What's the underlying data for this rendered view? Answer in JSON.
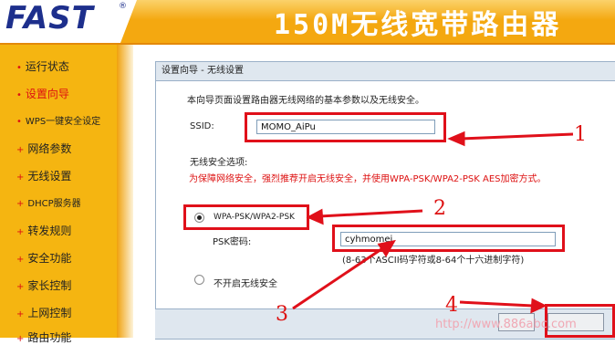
{
  "header": {
    "logo": "FAST",
    "trademark": "®",
    "product_title": "150M无线宽带路由器"
  },
  "sidebar": {
    "items": [
      {
        "label": "运行状态",
        "selected": false
      },
      {
        "label": "设置向导",
        "selected": true
      },
      {
        "label": "WPS一键安全设定",
        "selected": false
      },
      {
        "label": "网络参数",
        "selected": false
      },
      {
        "label": "无线设置",
        "selected": false
      },
      {
        "label": "DHCP服务器",
        "selected": false
      },
      {
        "label": "转发规则",
        "selected": false
      },
      {
        "label": "安全功能",
        "selected": false
      },
      {
        "label": "家长控制",
        "selected": false
      },
      {
        "label": "上网控制",
        "selected": false
      },
      {
        "label": "路由功能",
        "selected": false
      }
    ]
  },
  "panel": {
    "title": "设置向导 - 无线设置",
    "intro": "本向导页面设置路由器无线网络的基本参数以及无线安全。",
    "ssid_label": "SSID:",
    "ssid_value": "MOMO_AiPu",
    "security_label": "无线安全选项:",
    "warning": "为保障网络安全，强烈推荐开启无线安全，并使用WPA-PSK/WPA2-PSK AES加密方式。",
    "option_wpa": "WPA-PSK/WPA2-PSK",
    "psk_label": "PSK密码:",
    "psk_value": "cyhmomei",
    "psk_hint": "(8-63个ASCII码字符或8-64个十六进制字符)",
    "option_off": "不开启无线安全"
  },
  "annotations": [
    "1",
    "2",
    "3",
    "4"
  ],
  "watermark": "http://www.886abc.com",
  "colors": {
    "accent": "#f5b511",
    "annotation": "#e0101a",
    "logo": "#1d2f8c"
  }
}
